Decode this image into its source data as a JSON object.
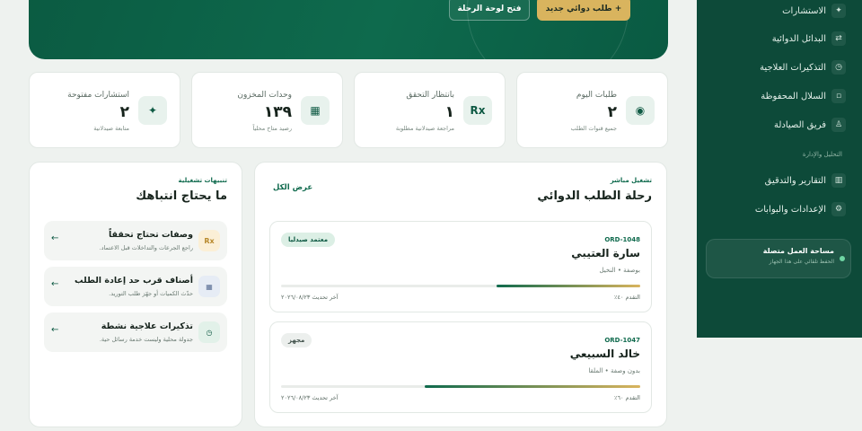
{
  "hero": {
    "new_order_label": "+ طلب دوائي جديد",
    "open_board_label": "فتح لوحة الرحلة"
  },
  "sidebar": {
    "items": [
      {
        "label": "الاستشارات",
        "icon": "sparkle-icon",
        "glyph": "✦"
      },
      {
        "label": "البدائل الدوائية",
        "icon": "swap-icon",
        "glyph": "⇄"
      },
      {
        "label": "التذكيرات العلاجية",
        "icon": "clock-icon",
        "glyph": "◷"
      },
      {
        "label": "السلال المحفوظة",
        "icon": "basket-icon",
        "glyph": "▫"
      },
      {
        "label": "فريق الصيادلة",
        "icon": "team-icon",
        "glyph": "♙"
      }
    ],
    "section_label": "التحليل والإدارة",
    "admin_items": [
      {
        "label": "التقارير والتدقيق",
        "icon": "report-icon",
        "glyph": "▥"
      },
      {
        "label": "الإعدادات والبوابات",
        "icon": "gear-icon",
        "glyph": "⚙"
      }
    ],
    "workspace": {
      "title": "مساحة العمل متصلة",
      "subtitle": "الحفظ تلقائي على هذا الجهاز"
    }
  },
  "stats": [
    {
      "label": "طلبات اليوم",
      "value": "٢",
      "sub": "جميع قنوات الطلب",
      "icon": "target-icon",
      "glyph": "◉"
    },
    {
      "label": "بانتظار التحقق",
      "value": "١",
      "sub": "مراجعة صيدلانية مطلوبة",
      "icon": "rx-icon",
      "glyph": "Rx"
    },
    {
      "label": "وحدات المخزون",
      "value": "١٣٩",
      "sub": "رصيد متاح محلياً",
      "icon": "inventory-icon",
      "glyph": "▦"
    },
    {
      "label": "استشارات مفتوحة",
      "value": "٢",
      "sub": "متابعة صيدلانية",
      "icon": "sparkle-icon",
      "glyph": "✦"
    }
  ],
  "journey": {
    "eyebrow": "تشغيل مباشر",
    "title": "رحلة الطلب الدوائي",
    "view_all": "عرض الكل",
    "orders": [
      {
        "id": "ORD-1048",
        "name": "سارة العتيبي",
        "meta": "بوصفة • النخيل",
        "badge": "معتمد صيدليا",
        "badge_tone": "green",
        "progress": 0.4,
        "progress_label": "التقدم ٤٠٪",
        "updated": "آخر تحديث ٢٠٢٦/٠٨/٢٣"
      },
      {
        "id": "ORD-1047",
        "name": "خالد السبيعي",
        "meta": "بدون وصفة • الملقا",
        "badge": "مجهز",
        "badge_tone": "gray",
        "progress": 0.6,
        "progress_label": "التقدم ٦٠٪",
        "updated": "آخر تحديث ٢٠٢٦/٠٨/٢٣"
      }
    ]
  },
  "alerts": {
    "eyebrow": "تنبيهات تشغيلية",
    "title": "ما يحتاج انتباهك",
    "items": [
      {
        "title": "وصفات تحتاج تحققاً",
        "desc": "راجع الجرعات والتداخلات قبل الاعتماد.",
        "icon": "rx-icon",
        "glyph": "Rx",
        "bg": "#fbefd6",
        "fg": "#b8892c"
      },
      {
        "title": "أصناف قرب حد إعادة الطلب",
        "desc": "حدّث الكميات أو جهّز طلب التوريد.",
        "icon": "inventory-icon",
        "glyph": "▦",
        "bg": "#e6ecf5",
        "fg": "#5a6f94"
      },
      {
        "title": "تذكيرات علاجية نشطة",
        "desc": "جدولة محلية وليست خدمة رسائل حية.",
        "icon": "clock-icon",
        "glyph": "◷",
        "bg": "#e2f1e9",
        "fg": "#0f5a44"
      }
    ],
    "arrow_glyph": "←"
  }
}
